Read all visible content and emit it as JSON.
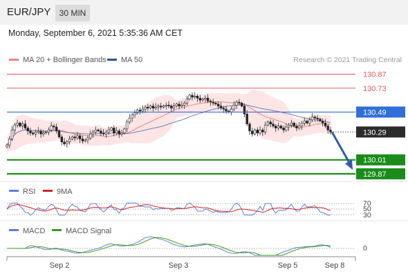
{
  "header": {
    "symbol": "EUR/JPY",
    "timeframe": "30 MIN",
    "datetime": "Monday, September 6, 2021 5:35:36 AM CET"
  },
  "chart_data": [
    {
      "type": "candlestick",
      "legend": [
        {
          "name": "MA 20 + Bollinger Bands",
          "color": "#f08080"
        },
        {
          "name": "MA 50",
          "color": "#2a4f8f"
        }
      ],
      "credit": "Research © 2021 Trading Central",
      "ylim": [
        129.8,
        130.95
      ],
      "current_price": 130.29,
      "levels": [
        {
          "value": 130.87,
          "label": "130.87",
          "color": "#e85a5a",
          "kind": "resistance"
        },
        {
          "value": 130.73,
          "label": "130.73",
          "color": "#e85a5a",
          "kind": "resistance"
        },
        {
          "value": 130.49,
          "label": "130.49",
          "color": "#2f6fd8",
          "kind": "pivot"
        },
        {
          "value": 130.01,
          "label": "130.01",
          "color": "#1a8c1a",
          "kind": "support"
        },
        {
          "value": 129.87,
          "label": "129.87",
          "color": "#1a8c1a",
          "kind": "support"
        }
      ],
      "forecast": {
        "from": 130.29,
        "to": 129.91
      },
      "x_ticks": [
        "Sep 2",
        "Sep 3",
        "Sep 5",
        "Sep 8"
      ],
      "candles_close": [
        130.16,
        130.22,
        130.31,
        130.36,
        130.38,
        130.35,
        130.37,
        130.33,
        130.3,
        130.28,
        130.27,
        130.29,
        130.3,
        130.27,
        130.28,
        130.29,
        130.31,
        130.35,
        130.34,
        130.3,
        130.24,
        130.19,
        130.17,
        130.19,
        130.22,
        130.24,
        130.23,
        130.25,
        130.22,
        130.2,
        130.21,
        130.23,
        130.27,
        130.29,
        130.31,
        130.3,
        130.28,
        130.27,
        130.29,
        130.31,
        130.33,
        130.28,
        130.3,
        130.27,
        130.28,
        130.32,
        130.39,
        130.43,
        130.46,
        130.48,
        130.51,
        130.5,
        130.52,
        130.54,
        130.53,
        130.55,
        130.53,
        130.54,
        130.55,
        130.54,
        130.55,
        130.56,
        130.55,
        130.53,
        130.55,
        130.57,
        130.55,
        130.56,
        130.58,
        130.62,
        130.66,
        130.64,
        130.65,
        130.63,
        130.61,
        130.62,
        130.63,
        130.6,
        130.59,
        130.58,
        130.57,
        130.55,
        130.53,
        130.52,
        130.5,
        130.49,
        130.52,
        130.56,
        130.59,
        130.58,
        130.55,
        130.47,
        130.37,
        130.3,
        130.27,
        130.31,
        130.28,
        130.31,
        130.29,
        130.36,
        130.39,
        130.37,
        130.35,
        130.33,
        130.35,
        130.33,
        130.31,
        130.34,
        130.36,
        130.38,
        130.35,
        130.33,
        130.35,
        130.38,
        130.4,
        130.38,
        130.41,
        130.44,
        130.43,
        130.42,
        130.4,
        130.38,
        130.35,
        130.31,
        130.29
      ],
      "rsi": {
        "legend": [
          {
            "name": "RSI",
            "color": "#5b7fd6"
          },
          {
            "name": "9MA",
            "color": "#d32222"
          }
        ],
        "levels": [
          "70",
          "50",
          "30"
        ]
      },
      "macd": {
        "legend": [
          {
            "name": "MACD",
            "color": "#5b7fd6"
          },
          {
            "name": "MACD Signal",
            "color": "#3a9a1a"
          }
        ],
        "zero_label": "0"
      }
    }
  ]
}
